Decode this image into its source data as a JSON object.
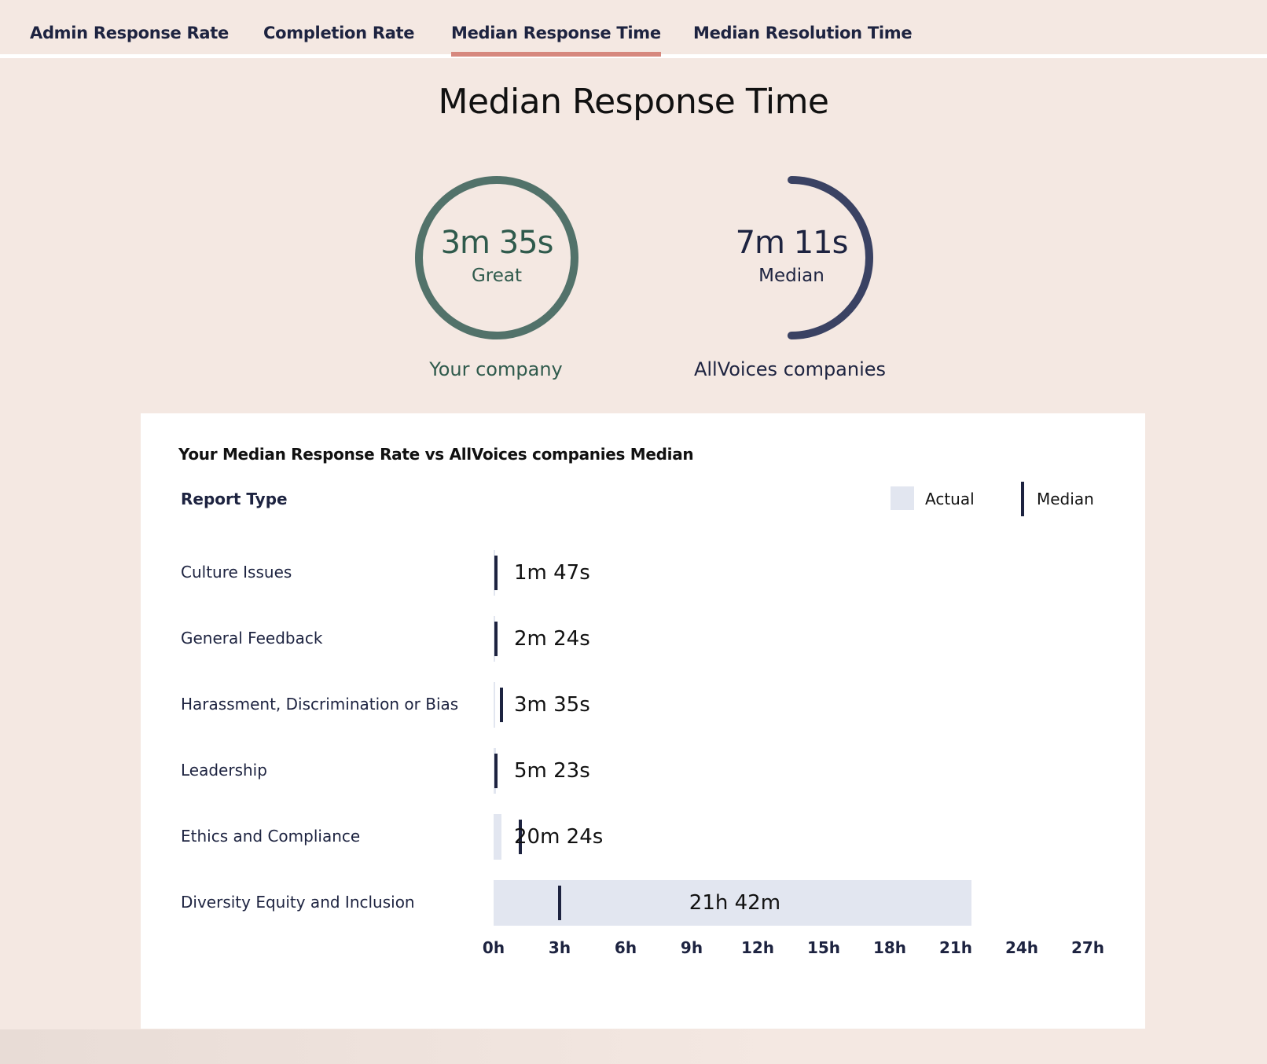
{
  "tabs": [
    {
      "label": "Admin Response Rate"
    },
    {
      "label": "Completion Rate"
    },
    {
      "label": "Median Response Time",
      "active": true
    },
    {
      "label": "Median Resolution Time"
    }
  ],
  "page_title": "Median Response Time",
  "your_company": {
    "value": "3m 35s",
    "rating": "Great",
    "caption": "Your company",
    "ring_fraction": 1.0,
    "color": "#52726a"
  },
  "allvoices": {
    "value": "7m 11s",
    "rating": "Median",
    "caption": "AllVoices companies",
    "ring_fraction": 0.5,
    "color": "#3a4263"
  },
  "chart_card": {
    "title": "Your Median Response Rate vs AllVoices companies Median",
    "column_header": "Report Type",
    "legend": {
      "actual": "Actual",
      "median": "Median"
    }
  },
  "chart_data": {
    "type": "bar",
    "orientation": "horizontal",
    "x_unit": "hours",
    "xlim": [
      0,
      27
    ],
    "ticks": [
      "0h",
      "3h",
      "6h",
      "9h",
      "12h",
      "15h",
      "18h",
      "21h",
      "24h",
      "27h"
    ],
    "categories": [
      "Culture Issues",
      "General Feedback",
      "Harassment, Discrimination or Bias",
      "Leadership",
      "Ethics and Compliance",
      "Diversity Equity and Inclusion"
    ],
    "series": [
      {
        "name": "Actual",
        "values": [
          0.03,
          0.04,
          0.06,
          0.09,
          0.34,
          21.7
        ],
        "labels": [
          "1m 47s",
          "2m 24s",
          "3m 35s",
          "5m 23s",
          "20m 24s",
          "21h 42m"
        ]
      },
      {
        "name": "Median",
        "values": [
          0.12,
          0.12,
          0.35,
          0.12,
          1.2,
          3.0
        ]
      }
    ]
  },
  "colors": {
    "background": "#f4e8e2",
    "tab_underline": "#d6887e",
    "bar_fill": "#e2e6f0",
    "median_mark": "#1d2340"
  }
}
